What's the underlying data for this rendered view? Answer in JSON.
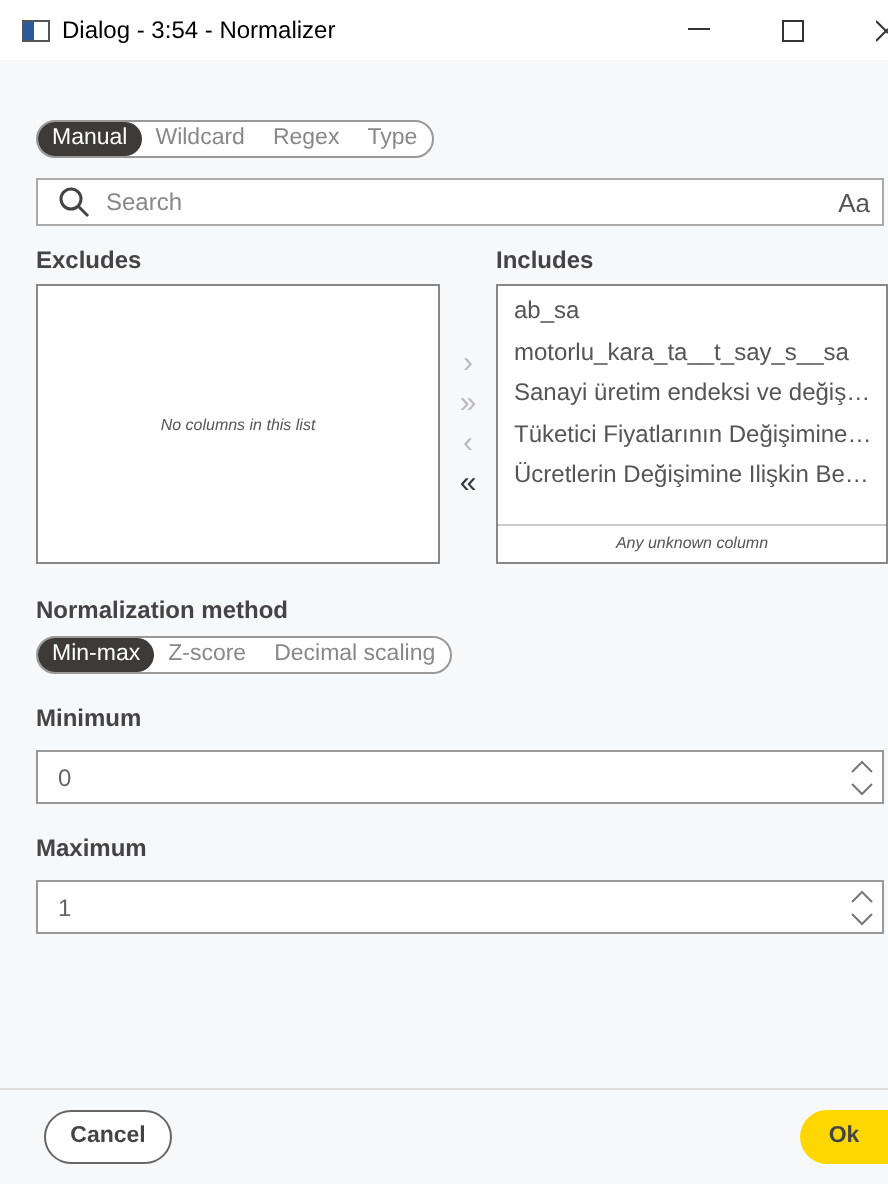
{
  "window": {
    "title": "Dialog - 3:54 - Normalizer"
  },
  "filter_tabs": [
    {
      "label": "Manual",
      "selected": true
    },
    {
      "label": "Wildcard",
      "selected": false
    },
    {
      "label": "Regex",
      "selected": false
    },
    {
      "label": "Type",
      "selected": false
    }
  ],
  "search": {
    "placeholder": "Search",
    "case_toggle": "Aa"
  },
  "excludes": {
    "label": "Excludes",
    "empty_text": "No columns in this list"
  },
  "move_buttons": [
    {
      "label": "›",
      "disabled": true
    },
    {
      "label": "»",
      "disabled": true
    },
    {
      "label": "‹",
      "disabled": true
    },
    {
      "label": "«",
      "disabled": false
    }
  ],
  "includes": {
    "label": "Includes",
    "items": [
      "ab_sa",
      "motorlu_kara_ta__t_say_s__sa",
      "Sanayi üretim endeksi ve değiş…",
      "Tüketici Fiyatlarının Değişimine…",
      "Ücretlerin Değişimine Ilişkin Be…"
    ],
    "footer": "Any unknown column"
  },
  "method": {
    "label": "Normalization method",
    "options": [
      {
        "label": "Min-max",
        "selected": true
      },
      {
        "label": "Z-score",
        "selected": false
      },
      {
        "label": "Decimal scaling",
        "selected": false
      }
    ]
  },
  "fields": [
    {
      "label": "Minimum",
      "value": "0"
    },
    {
      "label": "Maximum",
      "value": "1"
    }
  ],
  "buttons": {
    "cancel": "Cancel",
    "ok": "Ok"
  }
}
